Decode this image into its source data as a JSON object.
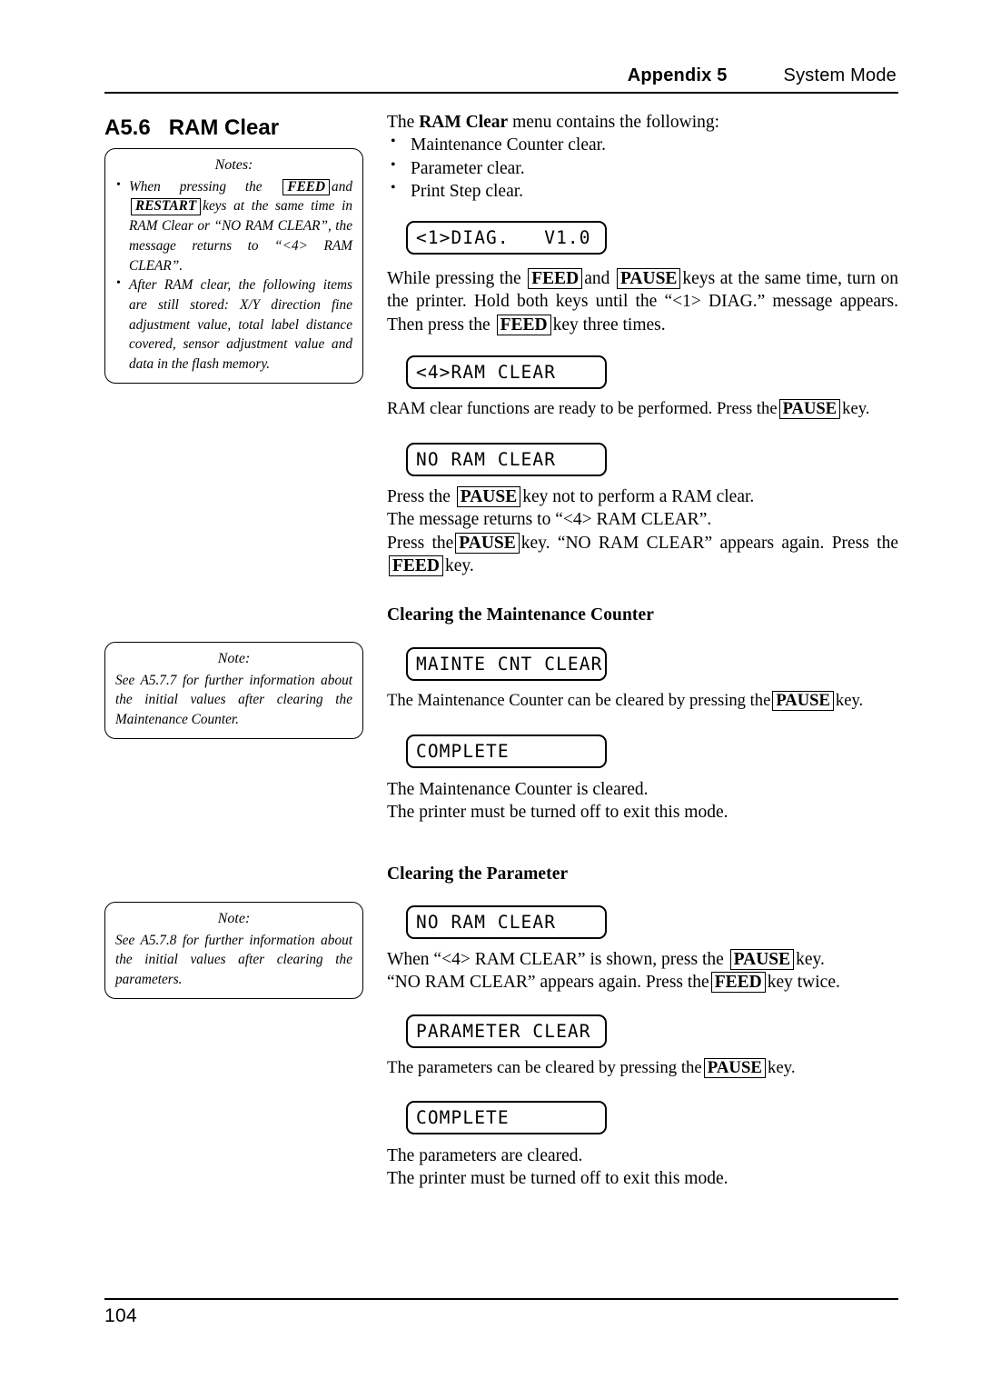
{
  "header": {
    "appendix": "Appendix 5",
    "mode": "System Mode"
  },
  "footer": {
    "page_number": "104"
  },
  "section": {
    "number": "A5.6",
    "title": "RAM Clear"
  },
  "notes_box_1": {
    "title": "Notes:",
    "item1_part1": "When pressing the",
    "item1_key1": "FEED",
    "item1_part2": "and",
    "item1_key2": "RESTART",
    "item1_part3": "keys at the same time in RAM Clear or “NO RAM CLEAR”, the message returns to “<4> RAM CLEAR”.",
    "item2": "After RAM clear, the following items are still stored: X/Y direction fine adjustment value, total label distance covered, sensor adjustment value and data in the flash memory."
  },
  "note_box_2": {
    "title": "Note:",
    "body": "See A5.7.7 for further information about the initial values after clearing the Maintenance Counter."
  },
  "note_box_3": {
    "title": "Note:",
    "body": "See A5.7.8 for further information about the initial values after clearing the parameters."
  },
  "intro": {
    "lead_pre": "The ",
    "lead_bold": "RAM Clear",
    "lead_post": " menu contains the following:",
    "bullets": [
      "Maintenance Counter clear.",
      "Parameter clear.",
      "Print Step clear."
    ]
  },
  "lcd": {
    "diag": "<1>DIAG.   V1.0",
    "ram_clear_4": "<4>RAM CLEAR",
    "no_ram_clear_1": "NO RAM CLEAR",
    "mainte_cnt_clear": "MAINTE CNT CLEAR",
    "complete_1": "COMPLETE",
    "no_ram_clear_2": "NO RAM CLEAR",
    "parameter_clear": "PARAMETER CLEAR",
    "complete_2": "COMPLETE"
  },
  "keys": {
    "feed": "FEED",
    "pause": "PAUSE",
    "restart": "RESTART"
  },
  "step_diag": {
    "t1": "While pressing the",
    "t2": "and",
    "t3": "keys at the same time, turn on the printer.  Hold both keys until the “<1> DIAG.” message appears.  Then press the",
    "t4": "key three times."
  },
  "step_ram_ready": {
    "t1": "RAM clear functions are ready to be performed.  Press the",
    "t2": "key."
  },
  "step_no_ram": {
    "l1_a": "Press the",
    "l1_b": "key not to perform a RAM clear.",
    "l2": "The message returns to “<4> RAM CLEAR”.",
    "l3_a": "Press the",
    "l3_b": "key.  “NO RAM CLEAR” appears again.  Press the",
    "l3_c": "key."
  },
  "maintenance_section": {
    "heading": "Clearing the Maintenance Counter",
    "desc_a": "The Maintenance Counter can be cleared by pressing the",
    "desc_b": "key.",
    "result_l1": "The Maintenance Counter is cleared.",
    "result_l2": "The printer must be turned off to exit this mode."
  },
  "parameter_section": {
    "heading": "Clearing the Parameter",
    "desc_l1_a": "When “<4> RAM CLEAR” is shown, press the",
    "desc_l1_b": "key.",
    "desc_l2_a": "“NO RAM CLEAR” appears again.  Press the",
    "desc_l2_b": "key twice.",
    "clear_a": "The parameters can be cleared by pressing the",
    "clear_b": "key.",
    "result_l1": "The parameters are cleared.",
    "result_l2": "The printer must be turned off to exit this mode."
  }
}
